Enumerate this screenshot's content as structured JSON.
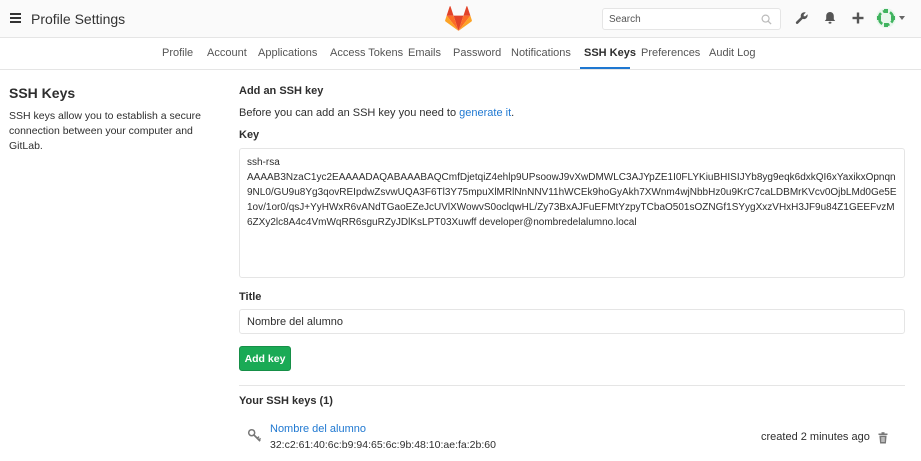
{
  "header": {
    "title": "Profile Settings",
    "search_placeholder": "Search"
  },
  "tabs": [
    {
      "label": "Profile"
    },
    {
      "label": "Account"
    },
    {
      "label": "Applications"
    },
    {
      "label": "Access Tokens"
    },
    {
      "label": "Emails"
    },
    {
      "label": "Password"
    },
    {
      "label": "Notifications"
    },
    {
      "label": "SSH Keys",
      "active": true
    },
    {
      "label": "Preferences"
    },
    {
      "label": "Audit Log"
    }
  ],
  "sidebar": {
    "title": "SSH Keys",
    "description": "SSH keys allow you to establish a secure connection between your computer and GitLab."
  },
  "form": {
    "heading": "Add an SSH key",
    "intro_text": "Before you can add an SSH key you need to ",
    "intro_link": "generate it",
    "intro_end": ".",
    "key_label": "Key",
    "key_value": "ssh-rsa\nAAAAB3NzaC1yc2EAAAADAQABAAABAQCmfDjetqiZ4ehlp9UPsoowJ9vXwDMWLC3AJYpZE1I0FLYKiuBHISIJYb8yg9eqk6dxkQI6xYaxikxOpnqn9NL0/GU9u8Yg3qovREIpdwZsvwUQA3F6Tl3Y75mpuXlMRlNnNNV11hWCEk9hoGyAkh7XWnm4wjNbbHz0u9KrC7caLDBMrKVcv0OjbLMd0Ge5E1ov/1or0/qsJ+YyHWxR6vANdTGaoEZeJcUVlXWowvS0oclqwHL/Zy73BxAJFuEFMtYzpyTCbaO501sOZNGf1SYygXxzVHxH3JF9u84Z1GEEFvzM6ZXy2lc8A4c4VmWqRR6sguRZyJDlKsLPT03Xuwff developer@nombredelalumno.local",
    "title_label": "Title",
    "title_value": "Nombre del alumno",
    "add_button": "Add key"
  },
  "keys_list": {
    "heading": "Your SSH keys (1)",
    "items": [
      {
        "name": "Nombre del alumno",
        "fingerprint": "32:c2:61:40:6c:b9:94:65:6c:9b:48:10:ae:fa:2b:60",
        "created": "created 2 minutes ago"
      }
    ]
  },
  "colors": {
    "accent": "#1f78d1",
    "success": "#1aaa55",
    "logo_orange": "#fc6d26"
  },
  "icons": [
    "menu-icon",
    "gitlab-logo",
    "search-icon",
    "wrench-icon",
    "bell-icon",
    "plus-icon",
    "avatar",
    "key-icon",
    "trash-icon"
  ]
}
